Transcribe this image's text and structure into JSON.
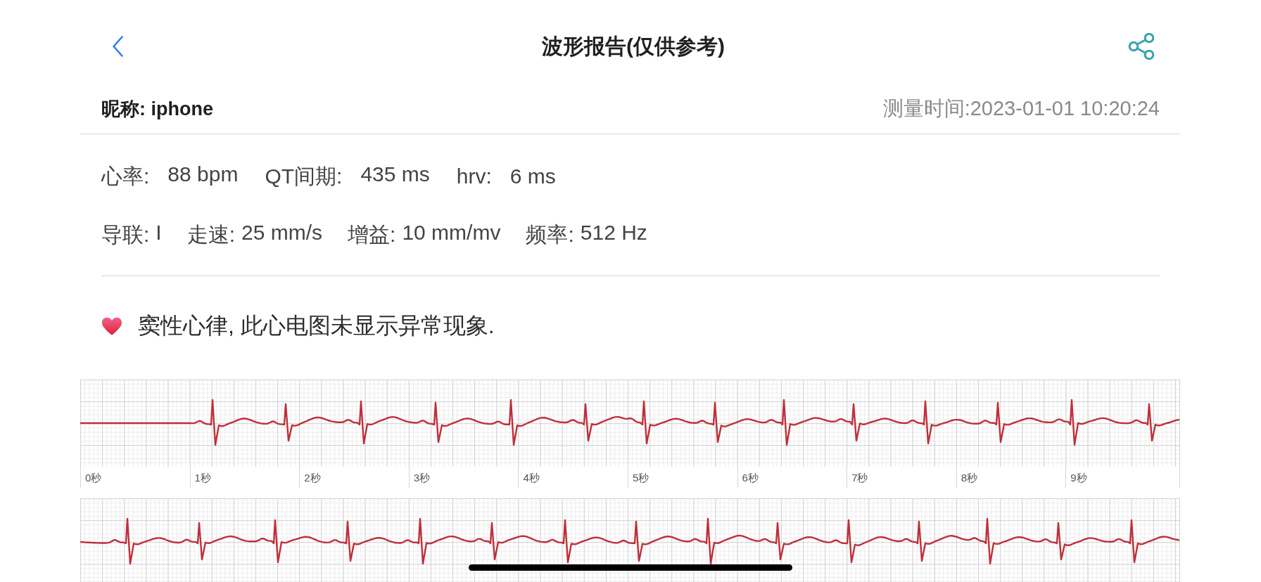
{
  "header": {
    "title": "波形报告(仅供参考)"
  },
  "info": {
    "nickname": "昵称: iphone",
    "measurement_time": "测量时间:2023-01-01 10:20:24"
  },
  "metric_rows": [
    {
      "items": [
        {
          "label": "心率:",
          "value": "88 bpm"
        },
        {
          "label": "QT间期:",
          "value": "435 ms"
        },
        {
          "label": "hrv:",
          "value": "6 ms"
        }
      ]
    },
    {
      "items": [
        {
          "label": "导联:",
          "value": "I"
        },
        {
          "label": "走速:",
          "value": "25 mm/s"
        },
        {
          "label": "增益:",
          "value": "10 mm/mv"
        },
        {
          "label": "频率:",
          "value": "512 Hz"
        }
      ]
    }
  ],
  "conclusion": {
    "text": "窦性心律, 此心电图未显示异常现象."
  },
  "ecg_strips": [
    {
      "kind": "lead_in",
      "time_labels": [
        "0秒",
        "1秒",
        "2秒",
        "3秒",
        "4秒",
        "5秒",
        "6秒",
        "7秒",
        "8秒",
        "9秒"
      ]
    },
    {
      "kind": "continuous"
    }
  ]
}
